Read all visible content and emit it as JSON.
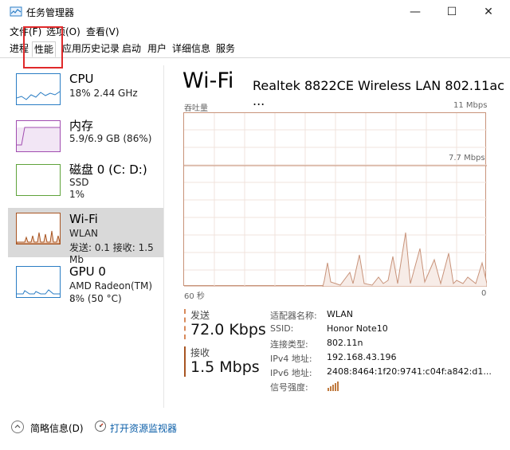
{
  "window": {
    "title": "任务管理器",
    "controls": [
      "—",
      "☐",
      "✕"
    ]
  },
  "menu": [
    "文件(F)",
    "选项(O)",
    "查看(V)"
  ],
  "tabs": [
    {
      "label": "进程",
      "active": false
    },
    {
      "label": "性能",
      "active": true
    },
    {
      "label": "应用历史记录",
      "active": false
    },
    {
      "label": "启动",
      "active": false
    },
    {
      "label": "用户",
      "active": false
    },
    {
      "label": "详细信息",
      "active": false
    },
    {
      "label": "服务",
      "active": false
    }
  ],
  "side": {
    "items": [
      {
        "name": "CPU",
        "sub1": "18%  2.44 GHz",
        "sub2": "",
        "color": "#2a7dc4"
      },
      {
        "name": "内存",
        "sub1": "5.9/6.9 GB (86%)",
        "sub2": "",
        "color": "#a14db0"
      },
      {
        "name": "磁盘 0 (C: D:)",
        "sub1": "SSD",
        "sub2": "1%",
        "color": "#5fa33b"
      },
      {
        "name": "Wi-Fi",
        "sub1": "WLAN",
        "sub2": "发送: 0.1 接收: 1.5 Mb",
        "color": "#a85522"
      },
      {
        "name": "GPU 0",
        "sub1": "AMD Radeon(TM) ...",
        "sub2": "8% (50 °C)",
        "color": "#2a7dc4"
      }
    ]
  },
  "main": {
    "title": "Wi-Fi",
    "adapter": "Realtek 8822CE Wireless LAN 802.11ac ...",
    "graph": {
      "label_left": "吞吐量",
      "label_right_top": "11 Mbps",
      "label_right_mid": "7.7 Mbps",
      "time_left": "60 秒",
      "time_right": "0",
      "accent": "#c8937a",
      "fill": "#f7ece7"
    },
    "stats": {
      "send_label": "发送",
      "send_value": "72.0 Kbps",
      "recv_label": "接收",
      "recv_value": "1.5 Mbps",
      "send_color": "#d88a5b",
      "recv_color": "#a85522"
    },
    "details": [
      {
        "k": "适配器名称:",
        "v": "WLAN"
      },
      {
        "k": "SSID:",
        "v": "Honor Note10"
      },
      {
        "k": "连接类型:",
        "v": "802.11n"
      },
      {
        "k": "IPv4 地址:",
        "v": "192.168.43.196"
      },
      {
        "k": "IPv6 地址:",
        "v": "2408:8464:1f20:9741:c04f:a842:d1..."
      },
      {
        "k": "信号强度:",
        "v": ""
      }
    ]
  },
  "footer": {
    "brief": "简略信息(D)",
    "monitor": "打开资源监视器"
  }
}
